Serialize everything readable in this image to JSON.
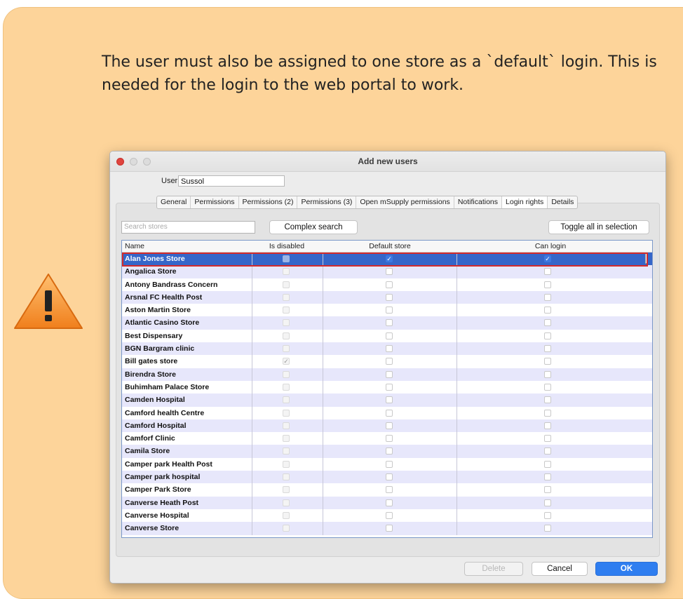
{
  "note": {
    "text": "The user must also be assigned to one store as a `default` login. This is needed for the login to the web portal to work."
  },
  "window": {
    "title": "Add new users",
    "user_label": "User",
    "user_value": "Sussol",
    "tabs": [
      "General",
      "Permissions",
      "Permissions (2)",
      "Permissions (3)",
      "Open mSupply permissions",
      "Notifications",
      "Login rights",
      "Details"
    ],
    "active_tab": "Login rights",
    "search_placeholder": "Search stores",
    "complex_search_label": "Complex search",
    "toggle_label": "Toggle all in selection",
    "columns": {
      "name": "Name",
      "is_disabled": "Is disabled",
      "default_store": "Default store",
      "can_login": "Can login"
    },
    "delete_label": "Delete",
    "cancel_label": "Cancel",
    "ok_label": "OK"
  },
  "stores": [
    {
      "name": "Alan Jones Store",
      "disabled": false,
      "default": true,
      "can_login": true,
      "selected": true
    },
    {
      "name": "Angalica Store",
      "disabled": false,
      "default": false,
      "can_login": false
    },
    {
      "name": "Antony Bandrass Concern",
      "disabled": false,
      "default": false,
      "can_login": false
    },
    {
      "name": "Arsnal FC Health Post",
      "disabled": false,
      "default": false,
      "can_login": false
    },
    {
      "name": "Aston Martin Store",
      "disabled": false,
      "default": false,
      "can_login": false
    },
    {
      "name": "Atlantic Casino Store",
      "disabled": false,
      "default": false,
      "can_login": false
    },
    {
      "name": "Best Dispensary",
      "disabled": false,
      "default": false,
      "can_login": false
    },
    {
      "name": "BGN Bargram clinic",
      "disabled": false,
      "default": false,
      "can_login": false
    },
    {
      "name": "Bill gates store",
      "disabled": true,
      "default": false,
      "can_login": false
    },
    {
      "name": "Birendra Store",
      "disabled": false,
      "default": false,
      "can_login": false
    },
    {
      "name": "Buhimham Palace Store",
      "disabled": false,
      "default": false,
      "can_login": false
    },
    {
      "name": "Camden Hospital",
      "disabled": false,
      "default": false,
      "can_login": false
    },
    {
      "name": "Camford health Centre",
      "disabled": false,
      "default": false,
      "can_login": false
    },
    {
      "name": "Camford Hospital",
      "disabled": false,
      "default": false,
      "can_login": false
    },
    {
      "name": "Camforf Clinic",
      "disabled": false,
      "default": false,
      "can_login": false
    },
    {
      "name": "Camila Store",
      "disabled": false,
      "default": false,
      "can_login": false
    },
    {
      "name": "Camper park Health Post",
      "disabled": false,
      "default": false,
      "can_login": false
    },
    {
      "name": "Camper park hospital",
      "disabled": false,
      "default": false,
      "can_login": false
    },
    {
      "name": "Camper Park Store",
      "disabled": false,
      "default": false,
      "can_login": false
    },
    {
      "name": "Canverse Heath Post",
      "disabled": false,
      "default": false,
      "can_login": false
    },
    {
      "name": "Canverse Hospital",
      "disabled": false,
      "default": false,
      "can_login": false
    },
    {
      "name": "Canverse Store",
      "disabled": false,
      "default": false,
      "can_login": false
    }
  ],
  "icons": {
    "warning": "warning-triangle-icon",
    "check": "checkmark-icon"
  },
  "colors": {
    "note_bg": "#fdd49a",
    "selection": "#3566c9",
    "highlight_border": "#d22b2b",
    "ok_button": "#2f7ef0",
    "warning_orange": "#f29b2f"
  }
}
